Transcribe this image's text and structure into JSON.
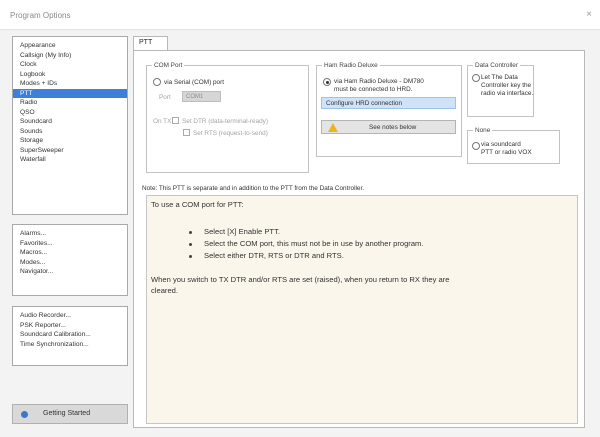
{
  "window": {
    "title": "Program Options",
    "close_glyph": "×"
  },
  "sidebar": {
    "group1": [
      "Appearance",
      "Callsign (My Info)",
      "Clock",
      "Logbook",
      "Modes + IDs",
      "PTT",
      "Radio",
      "QSO",
      "Soundcard",
      "Sounds",
      "Storage",
      "SuperSweeper",
      "Waterfall"
    ],
    "selected_index": 5,
    "group2": [
      "Alarms...",
      "Favorites...",
      "Macros...",
      "Modes...",
      "Navigator..."
    ],
    "group3": [
      "Audio Recorder...",
      "PSK Reporter...",
      "Soundcard Calibration...",
      "Time Synchronization..."
    ],
    "getting_started": "Getting Started",
    "getting_started_icon": "globe-icon"
  },
  "tab": {
    "label": "PTT"
  },
  "com_port": {
    "title": "COM Port",
    "radio_label": "via Serial (COM) port",
    "port_label": "Port",
    "port_value": "COM1",
    "on_tx_label": "On TX",
    "dtr_label": "Set DTR (data-terminal-ready)",
    "rts_label": "Set RTS (request-to-send)"
  },
  "hrd": {
    "title": "Ham Radio Deluxe",
    "radio_line1": "via Ham Radio Deluxe - DM780",
    "radio_line2": "must be connected to HRD.",
    "configure_label": "Configure HRD connection",
    "see_notes_label": "See notes below",
    "warning_icon": "warning-icon"
  },
  "data_controller": {
    "title": "Data Controller",
    "line1": "Let The Data",
    "line2": "Controller key the",
    "line3": "radio via interface."
  },
  "none_group": {
    "title": "None",
    "line1": "via soundcard",
    "line2": "PTT or radio VOX"
  },
  "note": "Note: This PTT is separate and in addition to the PTT from the Data Controller.",
  "info": {
    "intro": "To use a COM port for PTT:",
    "bullets": [
      "Select [X] Enable PTT.",
      "Select the COM port, this must not be in use by another program.",
      "Select either DTR, RTS or DTR and RTS."
    ],
    "outro_line1": "When you switch to TX DTR and/or RTS are set (raised), when you return to RX they are",
    "outro_line2": "cleared."
  },
  "colors": {
    "selected": "#3d7fd9",
    "info_bg": "#fbf6ec",
    "hrd_button": "#cfe2f7"
  }
}
